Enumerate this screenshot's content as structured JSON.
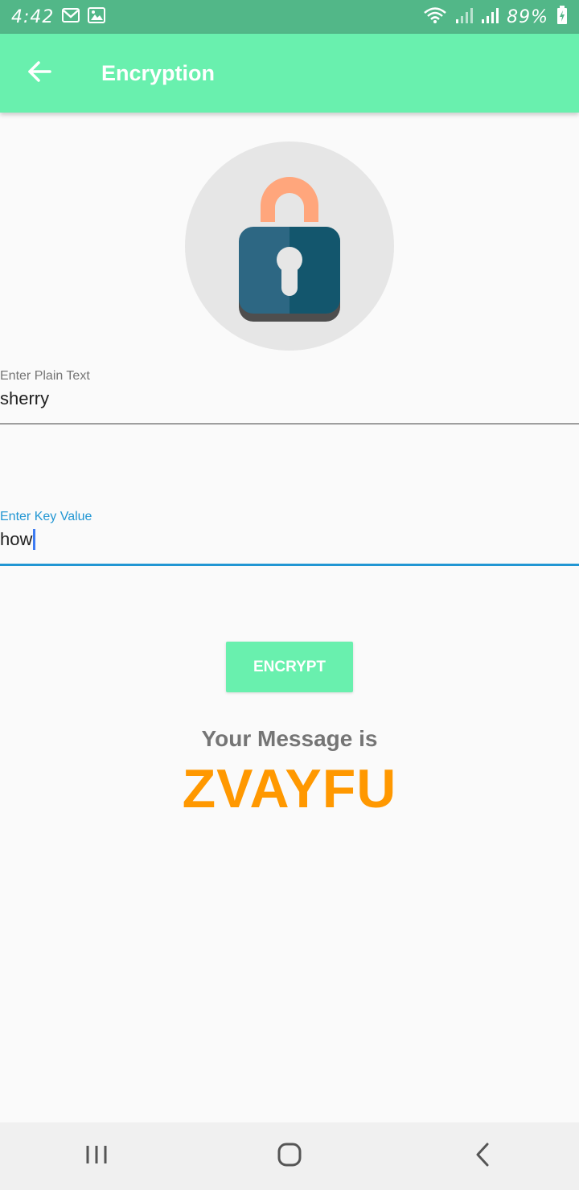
{
  "status_bar": {
    "time": "4:42",
    "battery_percent": "89%",
    "icons": [
      "gmail-icon",
      "image-icon",
      "wifi-icon",
      "signal-icon",
      "signal-icon",
      "battery-charging-icon"
    ]
  },
  "app_bar": {
    "title": "Encryption",
    "back_icon": "arrow-back-icon",
    "background": "#69f0ae"
  },
  "lock_image": {
    "icon": "padlock-icon"
  },
  "plain_text_field": {
    "label": "Enter Plain Text",
    "value": "sherry"
  },
  "key_field": {
    "label": "Enter Key Value",
    "value": "how",
    "focused": true
  },
  "encrypt_button": {
    "label": "ENCRYPT"
  },
  "result": {
    "label": "Your Message is",
    "value": "ZVAYFU"
  },
  "colors": {
    "accent": "#69f0ae",
    "status_bar": "#52b788",
    "focus": "#2196d3",
    "result": "#ff9800"
  },
  "nav_bar": {
    "icons": [
      "recents-icon",
      "home-icon",
      "back-icon"
    ]
  }
}
